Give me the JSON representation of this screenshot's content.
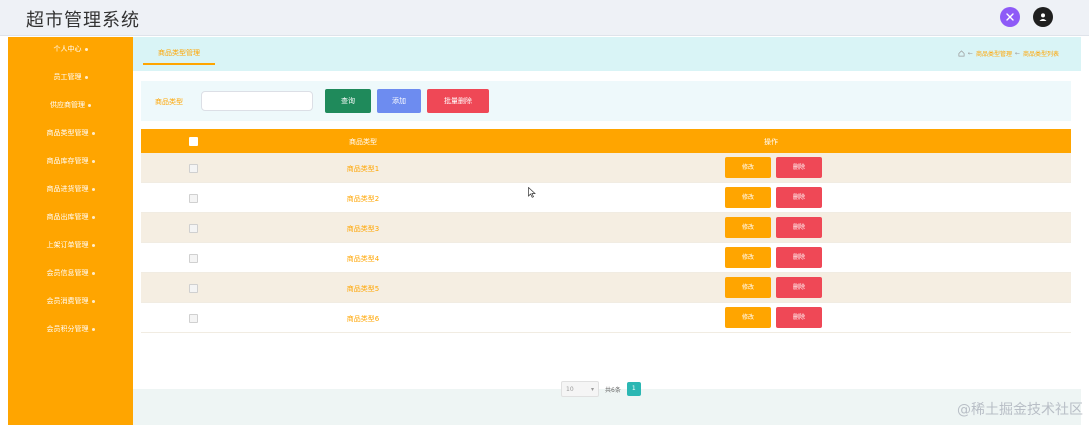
{
  "header": {
    "title": "超市管理系统",
    "icons": [
      "settings-icon",
      "user-icon"
    ]
  },
  "sidebar": {
    "items": [
      {
        "label": "个人中心"
      },
      {
        "label": "员工管理"
      },
      {
        "label": "供应商管理"
      },
      {
        "label": "商品类型管理"
      },
      {
        "label": "商品库存管理"
      },
      {
        "label": "商品进货管理"
      },
      {
        "label": "商品出库管理"
      },
      {
        "label": "上架订单管理"
      },
      {
        "label": "会员信息管理"
      },
      {
        "label": "会员消费管理"
      },
      {
        "label": "会员积分管理"
      }
    ]
  },
  "tabs": [
    {
      "label": "商品类型管理"
    }
  ],
  "breadcrumb": {
    "items": [
      "商品类型管理",
      "商品类型列表"
    ]
  },
  "search": {
    "label": "商品类型",
    "value": "",
    "placeholder": "",
    "query_label": "查询",
    "add_label": "添加",
    "batch_delete_label": "批量删除"
  },
  "table": {
    "headers": {
      "name": "商品类型",
      "operation": "操作"
    },
    "rows": [
      {
        "name": "商品类型1",
        "edit": "修改",
        "delete": "删除"
      },
      {
        "name": "商品类型2",
        "edit": "修改",
        "delete": "删除"
      },
      {
        "name": "商品类型3",
        "edit": "修改",
        "delete": "删除"
      },
      {
        "name": "商品类型4",
        "edit": "修改",
        "delete": "删除"
      },
      {
        "name": "商品类型5",
        "edit": "修改",
        "delete": "删除"
      },
      {
        "name": "商品类型6",
        "edit": "修改",
        "delete": "删除"
      }
    ]
  },
  "pagination": {
    "page_size": "10",
    "total": "共6条",
    "current_page": "1"
  },
  "watermark": "@稀土掘金技术社区",
  "colors": {
    "accent": "#ffa500",
    "danger": "#ef4856",
    "query": "#1f8a5b",
    "add": "#6d8cf0",
    "page_active": "#2bb7b3",
    "header_icon_1": "#8e5af7",
    "header_icon_2": "#1f1f1f"
  }
}
